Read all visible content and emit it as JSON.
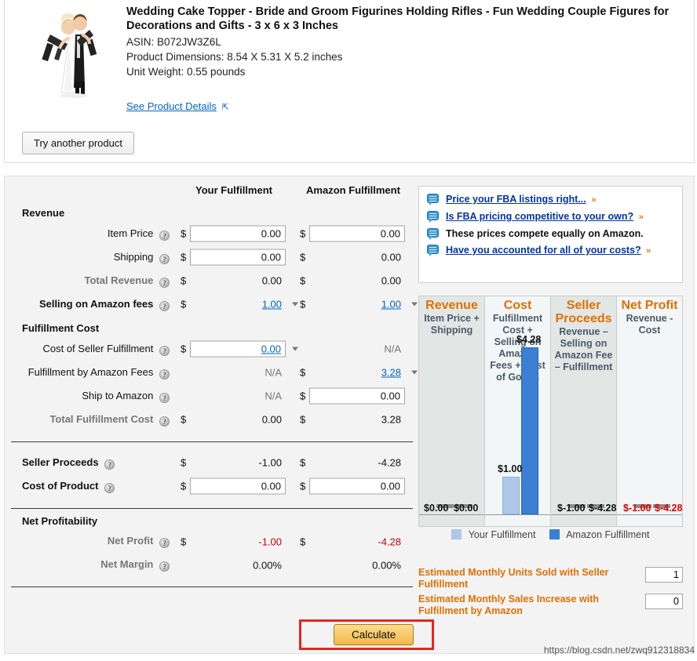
{
  "product": {
    "title": "Wedding Cake Topper - Bride and Groom Figurines Holding Rifles - Fun Wedding Couple Figures for Decorations and Gifts - 3 x 6 x 3 Inches",
    "asin": "ASIN: B072JW3Z6L",
    "dimensions": "Product Dimensions: 8.54 X 5.31 X 5.2 inches",
    "weight": "Unit Weight: 0.55 pounds",
    "see_details": "See Product Details",
    "popout_icon": "external-link-icon",
    "try_another": "Try another product",
    "image_alt": "wedding-cake-topper-thumbnail"
  },
  "table": {
    "headers": {
      "label": "",
      "yours": "Your Fulfillment",
      "amazon": "Amazon Fulfillment"
    },
    "sections": [
      {
        "title": "Revenue"
      },
      {
        "title": "Fulfillment Cost"
      },
      {
        "title": "Net Profitability"
      }
    ],
    "rows": {
      "item_price": {
        "label": "Item Price",
        "yours": "0.00",
        "amazon": "0.00"
      },
      "shipping": {
        "label": "Shipping",
        "yours": "0.00",
        "amazon": "0.00"
      },
      "total_revenue": {
        "label": "Total Revenue",
        "yours": "0.00",
        "amazon": "0.00"
      },
      "selling_fees": {
        "label": "Selling on Amazon fees",
        "yours": "1.00",
        "amazon": "1.00"
      },
      "cost_seller_ful": {
        "label": "Cost of Seller Fulfillment",
        "yours": "0.00",
        "amazon": "N/A"
      },
      "fba_fees": {
        "label": "Fulfillment by Amazon Fees",
        "yours": "N/A",
        "amazon": "3.28"
      },
      "ship_to_amazon": {
        "label": "Ship to Amazon",
        "yours": "N/A",
        "amazon": "0.00"
      },
      "total_ful_cost": {
        "label": "Total Fulfillment Cost",
        "yours": "0.00",
        "amazon": "3.28"
      },
      "seller_proceeds": {
        "label": "Seller Proceeds",
        "yours": "-1.00",
        "amazon": "-4.28"
      },
      "cost_of_product": {
        "label": "Cost of Product",
        "yours": "0.00",
        "amazon": "0.00"
      },
      "net_profit": {
        "label": "Net Profit",
        "yours": "-1.00",
        "amazon": "-4.28"
      },
      "net_margin": {
        "label": "Net Margin",
        "yours": "0.00%",
        "amazon": "0.00%"
      }
    },
    "currency": "$",
    "help_icon": "help-circle-icon",
    "calculate_button": "Calculate"
  },
  "tips": [
    {
      "text": "Price your FBA listings right...",
      "link": true,
      "chevron": "»"
    },
    {
      "text": "Is FBA pricing competitive to your own?",
      "link": true,
      "chevron": "»"
    },
    {
      "text": "These prices compete equally on Amazon.",
      "link": false,
      "chevron": ""
    },
    {
      "text": "Have you accounted for all of your costs?",
      "link": true,
      "chevron": "»"
    }
  ],
  "chart_data": {
    "type": "bar",
    "title": "",
    "categories": [
      "Revenue",
      "Cost",
      "Seller Proceeds",
      "Net Profit"
    ],
    "category_subtitles": [
      "Item Price + Shipping",
      "Fulfillment Cost + Selling on Amazon Fees + Cost of Goods",
      "Revenue – Selling on Amazon Fee – Fulfillment",
      "Revenue - Cost"
    ],
    "series": [
      {
        "name": "Your Fulfillment",
        "values": [
          0.0,
          1.0,
          -1.0,
          -1.0
        ],
        "color": "#aec7e8"
      },
      {
        "name": "Amazon Fulfillment",
        "values": [
          0.0,
          4.28,
          -4.28,
          -4.28
        ],
        "color": "#3b7fd4"
      }
    ],
    "value_labels": {
      "revenue": {
        "yours": "$0.00",
        "amazon": "$0.00"
      },
      "cost": {
        "yours": "$1.00",
        "amazon": "$4.28"
      },
      "seller_proceeds": {
        "yours": "$-1.00",
        "amazon": "$-4.28"
      },
      "net_profit": {
        "yours": "$-1.00",
        "amazon": "$-4.28"
      }
    },
    "ylim": [
      0,
      4.28
    ],
    "grid": false,
    "legend_position": "bottom",
    "legend": [
      "Your Fulfillment",
      "Amazon Fulfillment"
    ]
  },
  "estimates": [
    {
      "label": "Estimated Monthly Units Sold with Seller Fulfillment",
      "value": "1"
    },
    {
      "label": "Estimated Monthly Sales Increase with Fulfillment by Amazon",
      "value": "0"
    }
  ],
  "watermark": "https://blog.csdn.net/zwq912318834",
  "colors": {
    "accent_orange": "#e07000",
    "link_blue": "#0066c0",
    "negative_red": "#c40000",
    "button_gold": "#f1b94b",
    "highlight_red": "#f02020"
  }
}
